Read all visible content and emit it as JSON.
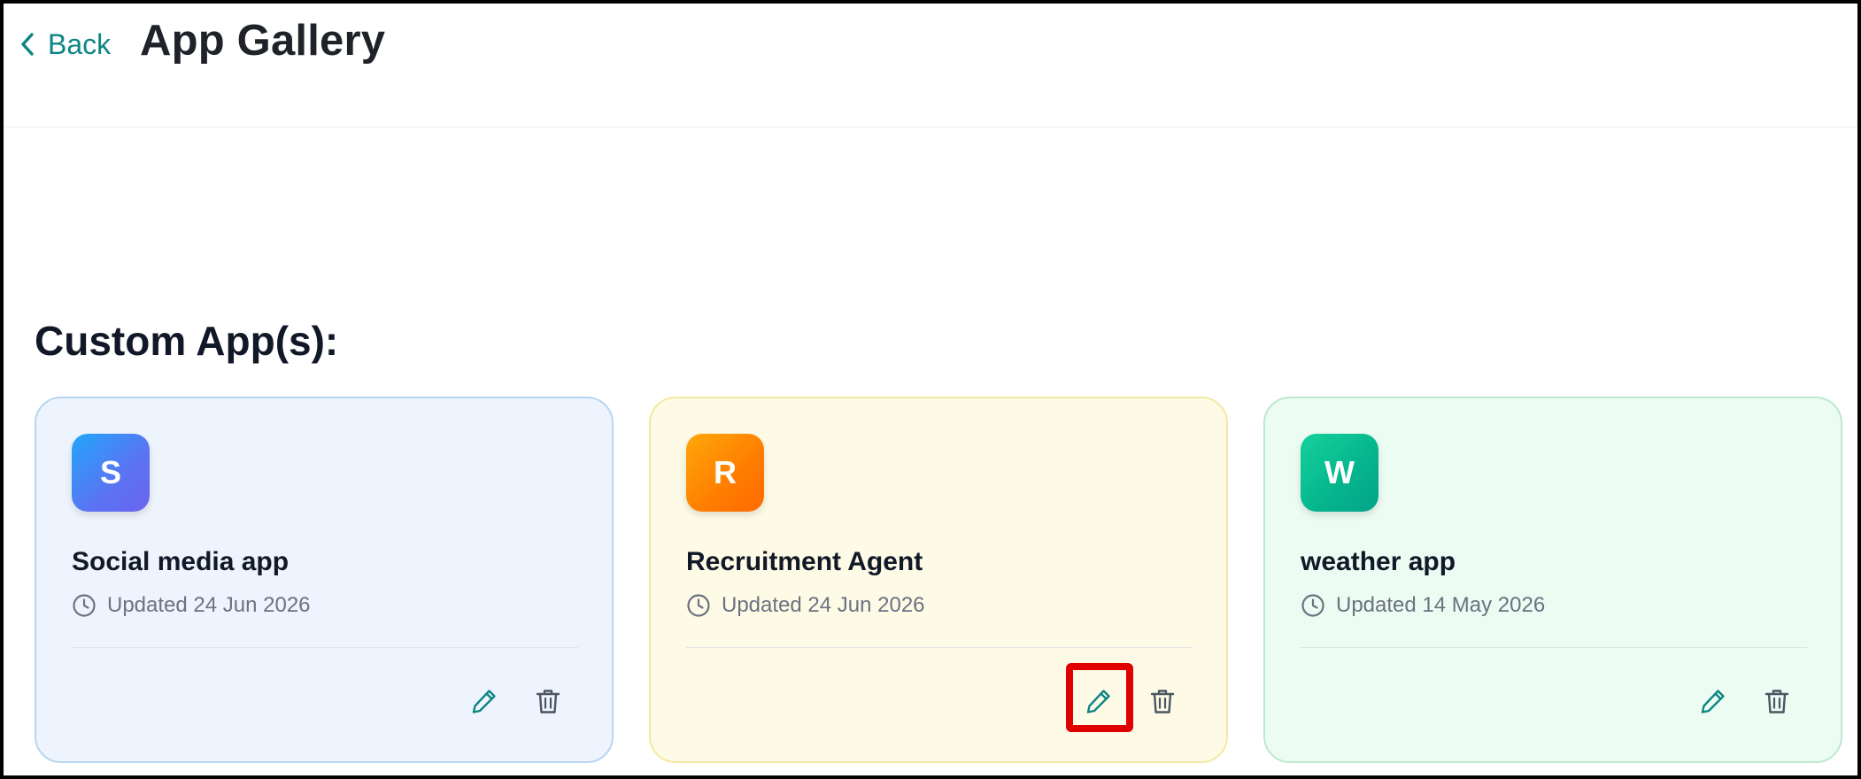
{
  "header": {
    "back_label": "Back",
    "title": "App Gallery"
  },
  "section": {
    "title": "Custom App(s):"
  },
  "apps": [
    {
      "initial": "S",
      "name": "Social media app",
      "updated": "Updated 24 Jun 2026",
      "theme": {
        "card_bg": "#eef4fe",
        "card_border": "#b8d5f2",
        "icon_from": "#22a6fb",
        "icon_to": "#6a64ef"
      }
    },
    {
      "initial": "R",
      "name": "Recruitment Agent",
      "updated": "Updated 24 Jun 2026",
      "theme": {
        "card_bg": "#fdfbe6",
        "card_border": "#f5e8a2",
        "icon_from": "#ffa70a",
        "icon_to": "#ff6a00"
      }
    },
    {
      "initial": "W",
      "name": "weather app",
      "updated": "Updated 14 May 2026",
      "theme": {
        "card_bg": "#ecfcf2",
        "card_border": "#bde9cf",
        "icon_from": "#14d19a",
        "icon_to": "#02a48a"
      }
    }
  ],
  "icons": {
    "back": "chevron-left-icon",
    "clock": "clock-icon",
    "edit": "pencil-icon",
    "delete": "trash-icon"
  },
  "colors": {
    "accent_teal": "#0e8585",
    "highlight_red": "#e00000",
    "muted_text": "#6b7280",
    "action_icon_gray": "#4b5563"
  }
}
